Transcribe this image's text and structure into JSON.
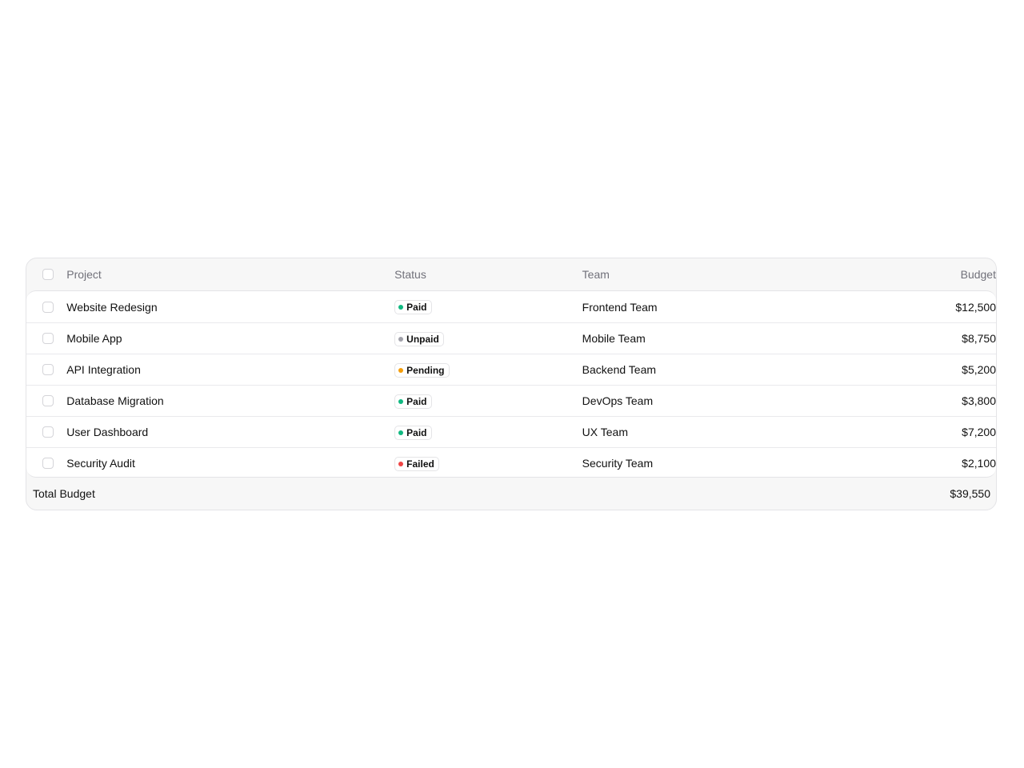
{
  "table": {
    "header": {
      "project": "Project",
      "status": "Status",
      "team": "Team",
      "budget": "Budget"
    },
    "rows": [
      {
        "project": "Website Redesign",
        "status": "Paid",
        "status_color": "#10b981",
        "team": "Frontend Team",
        "budget": "$12,500"
      },
      {
        "project": "Mobile App",
        "status": "Unpaid",
        "status_color": "#a1a1aa",
        "team": "Mobile Team",
        "budget": "$8,750"
      },
      {
        "project": "API Integration",
        "status": "Pending",
        "status_color": "#f59e0b",
        "team": "Backend Team",
        "budget": "$5,200"
      },
      {
        "project": "Database Migration",
        "status": "Paid",
        "status_color": "#10b981",
        "team": "DevOps Team",
        "budget": "$3,800"
      },
      {
        "project": "User Dashboard",
        "status": "Paid",
        "status_color": "#10b981",
        "team": "UX Team",
        "budget": "$7,200"
      },
      {
        "project": "Security Audit",
        "status": "Failed",
        "status_color": "#ef4444",
        "team": "Security Team",
        "budget": "$2,100"
      }
    ],
    "footer": {
      "label": "Total Budget",
      "total": "$39,550"
    }
  }
}
